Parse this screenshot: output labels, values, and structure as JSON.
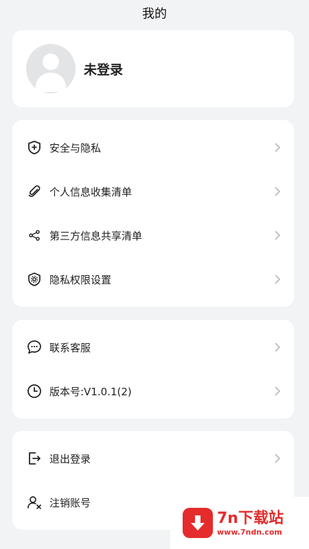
{
  "header": {
    "title": "我的"
  },
  "profile": {
    "username": "未登录"
  },
  "group1": [
    {
      "label": "安全与隐私",
      "icon": "shield-plus-icon"
    },
    {
      "label": "个人信息收集清单",
      "icon": "paperclip-icon"
    },
    {
      "label": "第三方信息共享清单",
      "icon": "share-icon"
    },
    {
      "label": "隐私权限设置",
      "icon": "gear-shield-icon"
    }
  ],
  "group2": [
    {
      "label": "联系客服",
      "icon": "chat-bubble-icon"
    },
    {
      "label": "版本号:V1.0.1(2)",
      "icon": "clock-icon"
    }
  ],
  "group3": [
    {
      "label": "退出登录",
      "icon": "logout-icon"
    },
    {
      "label": "注销账号",
      "icon": "user-remove-icon"
    }
  ],
  "watermark": {
    "title": "7n下载站",
    "url": "www.7ndn.com",
    "accent": "#e52b2b"
  }
}
